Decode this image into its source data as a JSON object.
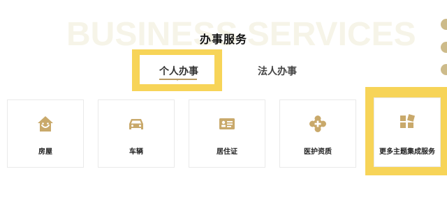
{
  "section": {
    "watermark": "BUSINESS SERVICES",
    "title": "办事服务"
  },
  "tabs": [
    {
      "label": "个人办事",
      "active": true
    },
    {
      "label": "法人办事",
      "active": false
    }
  ],
  "cards": [
    {
      "label": "房屋",
      "icon": "house-icon"
    },
    {
      "label": "车辆",
      "icon": "car-icon"
    },
    {
      "label": "居住证",
      "icon": "id-card-icon"
    },
    {
      "label": "医护资质",
      "icon": "medical-cross-icon"
    },
    {
      "label": "更多主题集成服务",
      "icon": "grid-apps-icon"
    }
  ],
  "colors": {
    "accent_gold": "#c9a96b",
    "highlight_yellow": "#f7d458",
    "watermark": "#f6f4e8"
  }
}
